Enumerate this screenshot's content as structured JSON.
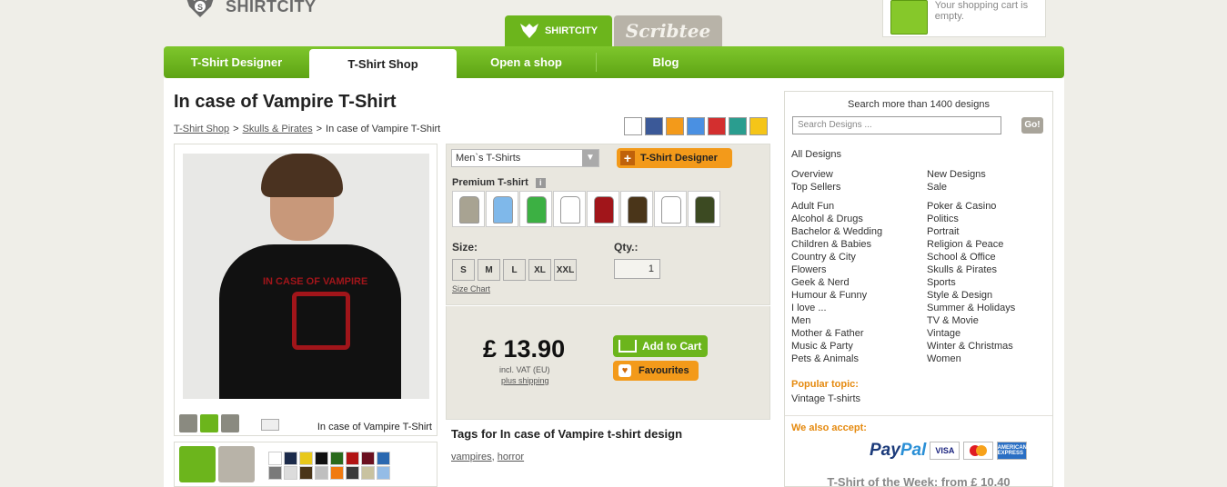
{
  "header": {
    "logo_text": "SHIRTCITY",
    "cart_text": "Your shopping cart is empty.",
    "brand_tabs": [
      "SHIRTCITY",
      "Scribtee"
    ]
  },
  "nav": {
    "items": [
      {
        "label": "T-Shirt Designer",
        "active": false
      },
      {
        "label": "T-Shirt Shop",
        "active": true
      },
      {
        "label": "Open a shop",
        "active": false
      },
      {
        "label": "Blog",
        "active": false
      }
    ]
  },
  "product": {
    "title": "In case of Vampire T-Shirt",
    "breadcrumb": [
      "T-Shirt Shop",
      ">",
      "Skulls & Pirates",
      ">",
      "In case of Vampire T-Shirt"
    ],
    "print_text": "IN CASE OF VAMPIRE",
    "image_caption": "In case of Vampire T-Shirt",
    "type_select": "Men`s T-Shirts",
    "designer_button": "T-Shirt Designer",
    "premium_label": "Premium T-shirt",
    "info_icon": "i",
    "shirt_colors": [
      "#a8a392",
      "#7fb8ea",
      "#3cb043",
      "#ffffff",
      "#a1151a",
      "#4a3519",
      "#ffffff",
      "#3c4a22"
    ],
    "size_label": "Size:",
    "qty_label": "Qty.:",
    "sizes": [
      "S",
      "M",
      "L",
      "XL",
      "XXL"
    ],
    "qty_value": "1",
    "size_chart": "Size Chart",
    "price": "£ 13.90",
    "vat": "incl. VAT (EU)",
    "shipping": "plus shipping",
    "add_to_cart": "Add to Cart",
    "favourites": "Favourites",
    "tags_title": "Tags for In case of Vampire t-shirt design",
    "tags": [
      "vampires",
      "horror"
    ],
    "garment_colors": [
      "#ffffff",
      "#1b2a4a",
      "#e8c81a",
      "#111111",
      "#2a6a1c",
      "#b21414",
      "#6a1020",
      "#2a68b0",
      "#7a7a7a",
      "#dcdcdc",
      "#4a3519",
      "#bfbfbf",
      "#f07a10",
      "#3a3a3a",
      "#c8c2a0",
      "#94bce6"
    ]
  },
  "sidebar": {
    "search_title": "Search more than 1400 designs",
    "search_placeholder": "Search Designs ...",
    "go_label": "Go!",
    "all_designs": "All Designs",
    "col1_group1": [
      "Overview",
      "Top Sellers"
    ],
    "col2_group1": [
      "New Designs",
      "Sale"
    ],
    "col1_group2": [
      "Adult Fun",
      "Alcohol & Drugs",
      "Bachelor & Wedding",
      "Children & Babies",
      "Country & City",
      "Flowers",
      "Geek & Nerd",
      "Humour & Funny",
      "I love ...",
      "Men",
      "Mother & Father",
      "Music & Party",
      "Pets & Animals"
    ],
    "col2_group2": [
      "Poker & Casino",
      "Politics",
      "Portrait",
      "Religion & Peace",
      "School & Office",
      "Skulls & Pirates",
      "Sports",
      "Style & Design",
      "Summer & Holidays",
      "TV & Movie",
      "Vintage",
      "Winter & Christmas",
      "Women"
    ],
    "popular_label": "Popular topic:",
    "popular_value": "Vintage T-shirts",
    "accept_label": "We also accept:",
    "paypal_a": "Pay",
    "paypal_b": "Pal",
    "visa": "VISA",
    "amex": "AMERICAN EXPRESS",
    "tshirt_week": "T-Shirt of the Week: from £ 10.40"
  }
}
